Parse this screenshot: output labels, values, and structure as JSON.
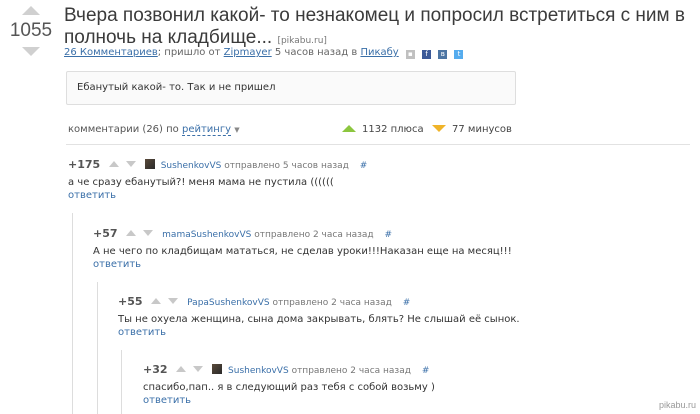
{
  "post": {
    "rating": "1055",
    "title": "Вчера позвонил какой- то незнакомец и попросил встретиться с ним в полночь на кладбище...",
    "source": "[pikabu.ru]",
    "comments_link": "26 Комментариев",
    "meta_sep": "; пришло от",
    "author": "Zipmayer",
    "time": "5 часов назад в",
    "section": "Пикабу",
    "body": "Ебанутый какой- то. Так и не пришел"
  },
  "sort": {
    "label": "комментарии (26) по",
    "value": "рейтингу",
    "pluses": "1132 плюса",
    "minuses": "77 минусов"
  },
  "comments": [
    {
      "rating": "+175",
      "user": "SushenkovVS",
      "time": "отправлено 5 часов назад",
      "hash": "#",
      "text": "а че сразу ебанутый?! меня мама не пустила ((((((",
      "reply": "ответить",
      "avatar": true
    },
    {
      "rating": "+57",
      "user": "mamaSushenkovVS",
      "time": "отправлено 2 часа назад",
      "hash": "#",
      "text": "А не чего по кладбищам мататься, не сделав уроки!!!Наказан еще на месяц!!!",
      "reply": "ответить",
      "avatar": false
    },
    {
      "rating": "+55",
      "user": "PapaSushenkovVS",
      "time": "отправлено 2 часа назад",
      "hash": "#",
      "text": "Ты не охуела женщина, сына дома закрывать, блять? Не слышай её сынок.",
      "reply": "ответить",
      "avatar": false
    },
    {
      "rating": "+32",
      "user": "SushenkovVS",
      "time": "отправлено 2 часа назад",
      "hash": "#",
      "text": "спасибо,пап.. я в следующий раз тебя с собой возьму )",
      "reply": "ответить",
      "avatar": true
    }
  ],
  "watermark": "pikabu.ru",
  "colors": {
    "link": "#3a6fa8",
    "plus": "#8cc63f",
    "minus": "#f0b429"
  },
  "icons": [
    "post-upvote-icon",
    "post-downvote-icon",
    "save-icon",
    "facebook-icon",
    "vkontakte-icon",
    "twitter-icon"
  ]
}
